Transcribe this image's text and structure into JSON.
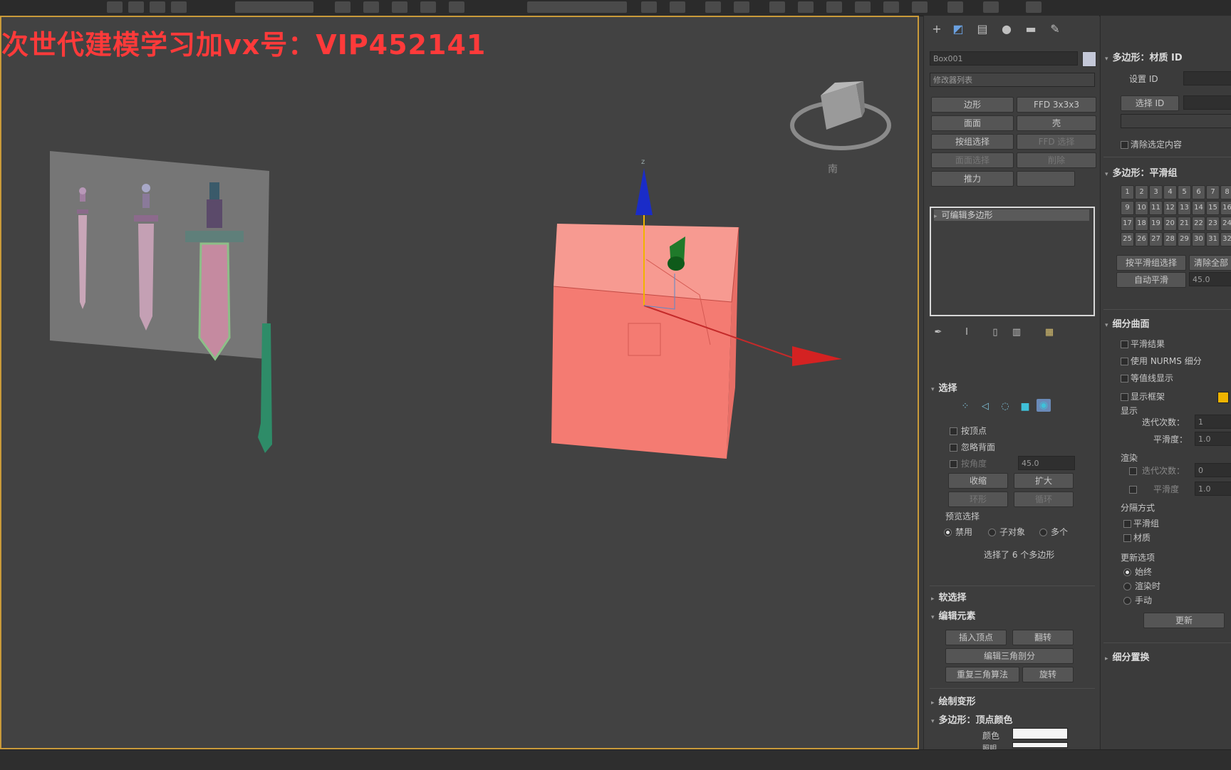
{
  "watermark": "次世代建模学习加vx号：VIP452141",
  "viewport": {
    "gizmo_z": "z"
  },
  "cmd_panel": {
    "object_name": "Box001",
    "modifier_list": "修改器列表",
    "buttons": [
      "边形",
      "FFD 3x3x3",
      "面面",
      "壳",
      "按组选择",
      "FFD 选择",
      "面面选择",
      "削除",
      "推力",
      ""
    ],
    "stack_item": "可编辑多边形",
    "selection": {
      "title": "选择",
      "by_vertex": "按顶点",
      "ignore_backfacing": "忽略背面",
      "by_angle": "按角度",
      "angle_val": "45.0",
      "shrink": "收缩",
      "grow": "扩大",
      "ring": "环形",
      "loop": "循环",
      "preview_label": "预览选择",
      "preview_off": "禁用",
      "preview_subobj": "子对象",
      "preview_multi": "多个",
      "status": "选择了 6 个多边形"
    },
    "soft_selection": "软选择",
    "edit_elements": {
      "title": "编辑元素",
      "insert_vertex": "插入顶点",
      "flip": "翻转",
      "edit_triangulation": "编辑三角剖分",
      "retriangulate": "重复三角算法",
      "turn": "旋转"
    },
    "paint_deform": "绘制变形",
    "vertex_colors": {
      "title": "多边形：顶点颜色",
      "color": "颜色",
      "illum": "照明"
    }
  },
  "right_panel": {
    "material_ids": {
      "title": "多边形：材质 ID",
      "set_id": "设置 ID",
      "select_id": "选择 ID",
      "clear_selection": "清除选定内容"
    },
    "smoothing_groups": {
      "title": "多边形：平滑组",
      "groups": [
        "1",
        "2",
        "3",
        "4",
        "5",
        "6",
        "7",
        "8",
        "9",
        "10",
        "11",
        "12",
        "13",
        "14",
        "15",
        "16",
        "17",
        "18",
        "19",
        "20",
        "21",
        "22",
        "23",
        "24",
        "25",
        "26",
        "27",
        "28",
        "29",
        "30",
        "31",
        "32"
      ],
      "select_by_sg": "按平滑组选择",
      "clear_all": "清除全部",
      "auto_smooth": "自动平滑",
      "auto_smooth_val": "45.0"
    },
    "subdivision_surface": {
      "title": "细分曲面",
      "smooth_result": "平滑结果",
      "use_nurms": "使用 NURMS 细分",
      "isoline_display": "等值线显示",
      "show_cage": "显示框架",
      "display_label": "显示",
      "iterations_label": "迭代次数：",
      "iterations_val": "1",
      "smoothness_label": "平滑度：",
      "smoothness_val": "1.0",
      "render_label": "渲染",
      "render_iterations": "迭代次数：",
      "render_iter_val": "0",
      "render_smoothness": "平滑度",
      "render_smooth_val": "1.0",
      "separate_by": "分隔方式",
      "smoothing_groups": "平滑组",
      "materials": "材质",
      "update_options": "更新选项",
      "always": "始终",
      "when_rendering": "渲染时",
      "manually": "手动",
      "update_btn": "更新"
    },
    "subdivision_displacement": "细分置换"
  },
  "colors": {
    "cage": "#f0b400",
    "box": "#f47b72",
    "accent": "#c99a3a"
  }
}
